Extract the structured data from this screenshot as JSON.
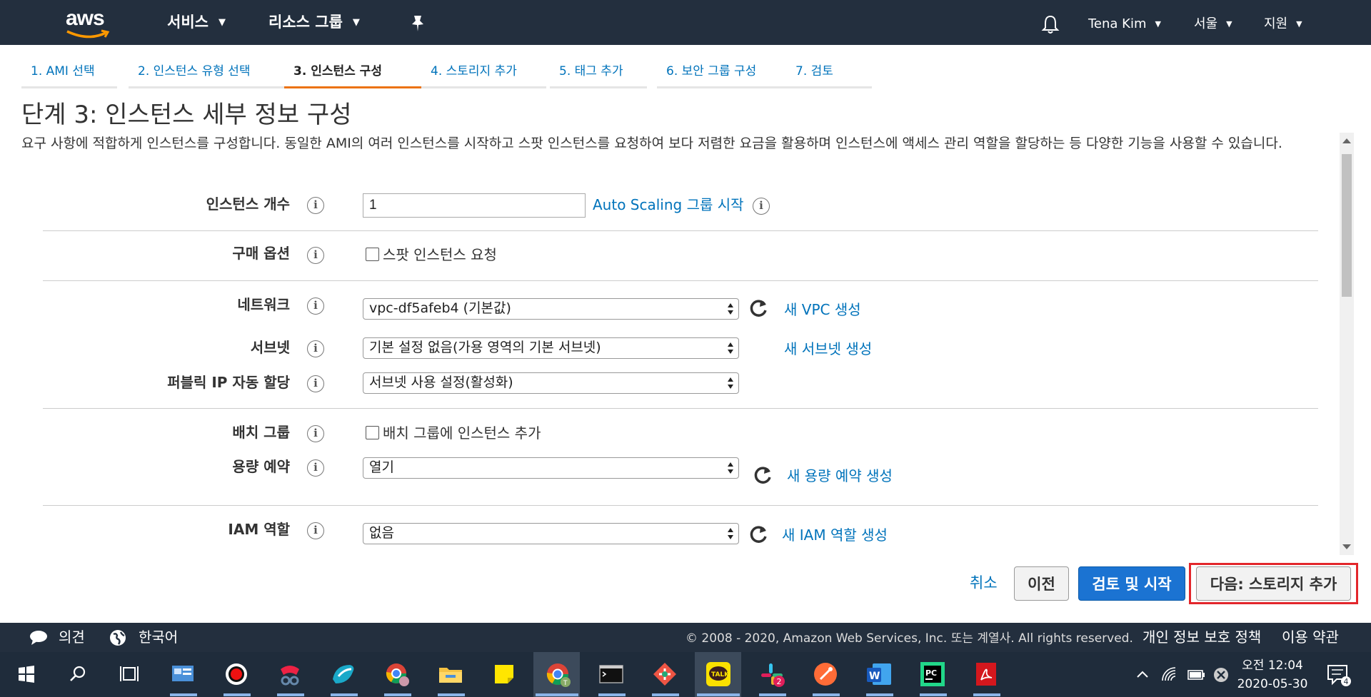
{
  "nav": {
    "logo": "aws",
    "services": "서비스",
    "resource_groups": "리소스 그룹",
    "user": "Tena Kim",
    "region": "서울",
    "support": "지원"
  },
  "tabs": [
    {
      "label": "1. AMI 선택"
    },
    {
      "label": "2. 인스턴스 유형 선택"
    },
    {
      "label": "3. 인스턴스 구성"
    },
    {
      "label": "4. 스토리지 추가"
    },
    {
      "label": "5. 태그 추가"
    },
    {
      "label": "6. 보안 그룹 구성"
    },
    {
      "label": "7. 검토"
    }
  ],
  "page": {
    "title": "단계 3: 인스턴스 세부 정보 구성",
    "description": "요구 사항에 적합하게 인스턴스를 구성합니다. 동일한 AMI의 여러 인스턴스를 시작하고 스팟 인스턴스를 요청하여 보다 저렴한 요금을 활용하며 인스턴스에 액세스 관리 역할을 할당하는 등 다양한 기능을 사용할 수 있습니다."
  },
  "form": {
    "instance_count": {
      "label": "인스턴스 개수",
      "value": "1",
      "link": "Auto Scaling 그룹 시작"
    },
    "purchase": {
      "label": "구매 옵션",
      "checkbox": "스팟 인스턴스 요청"
    },
    "network": {
      "label": "네트워크",
      "value": "vpc-df5afeb4 (기본값)",
      "link": "새 VPC 생성"
    },
    "subnet": {
      "label": "서브넷",
      "value": "기본 설정 없음(가용 영역의 기본 서브넷)",
      "link": "새 서브넷 생성"
    },
    "public_ip": {
      "label": "퍼블릭 IP 자동 할당",
      "value": "서브넷 사용 설정(활성화)"
    },
    "placement": {
      "label": "배치 그룹",
      "checkbox": "배치 그룹에 인스턴스 추가"
    },
    "capacity": {
      "label": "용량 예약",
      "value": "열기",
      "link": "새 용량 예약 생성"
    },
    "iam": {
      "label": "IAM 역할",
      "value": "없음",
      "link": "새 IAM 역할 생성"
    }
  },
  "actions": {
    "cancel": "취소",
    "previous": "이전",
    "review": "검토 및 시작",
    "next": "다음: 스토리지 추가"
  },
  "footer": {
    "feedback": "의견",
    "language": "한국어",
    "copyright": "© 2008 - 2020, Amazon Web Services, Inc. 또는 계열사. All rights reserved.",
    "privacy": "개인 정보 보호 정책",
    "terms": "이용 약관"
  },
  "taskbar": {
    "time": "오전 12:04",
    "date": "2020-05-30",
    "notification_count": "4",
    "slack_badge": "2"
  },
  "colors": {
    "nav_bg": "#232f3e",
    "link": "#0073bb",
    "active_tab": "#ec7211",
    "primary_button": "#1b73d2",
    "highlight_box": "#e3262b"
  }
}
